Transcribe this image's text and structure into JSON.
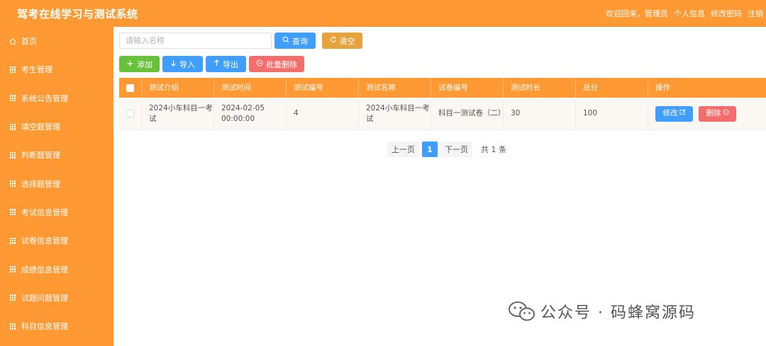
{
  "header": {
    "app_title": "驾考在线学习与测试系统",
    "welcome": "欢迎回来，管理员",
    "links": [
      "个人信息",
      "修改密码",
      "注销"
    ]
  },
  "sidebar": {
    "items": [
      {
        "label": "首页",
        "icon": "home-icon"
      },
      {
        "label": "考生管理",
        "icon": "grid-icon"
      },
      {
        "label": "系统公告管理",
        "icon": "grid-icon"
      },
      {
        "label": "填空题管理",
        "icon": "grid-icon"
      },
      {
        "label": "判断题管理",
        "icon": "grid-icon"
      },
      {
        "label": "选择题管理",
        "icon": "grid-icon"
      },
      {
        "label": "考试信息管理",
        "icon": "grid-icon"
      },
      {
        "label": "试卷信息管理",
        "icon": "grid-icon"
      },
      {
        "label": "成绩信息管理",
        "icon": "grid-icon"
      },
      {
        "label": "试题问题管理",
        "icon": "grid-icon"
      },
      {
        "label": "科目信息管理",
        "icon": "grid-icon"
      }
    ]
  },
  "search": {
    "placeholder": "请输入名称",
    "value": "",
    "query_label": "查询",
    "reset_label": "清空"
  },
  "toolbar": {
    "add_label": "添加",
    "import_label": "导入",
    "export_label": "导出",
    "batch_delete_label": "批量删除"
  },
  "table": {
    "columns": [
      "测试介绍",
      "测试时间",
      "测试编号",
      "测试名称",
      "试卷编号",
      "测试时长",
      "总分",
      "操作"
    ],
    "rows": [
      {
        "intro": "2024小车科目一考试",
        "time": "2024-02-05 00:00:00",
        "code": "4",
        "name": "2024小车科目一考试",
        "paper": "科目一测试卷（二）",
        "duration": "30",
        "score": "100",
        "edit_label": "修改",
        "delete_label": "删除"
      }
    ]
  },
  "pagination": {
    "prev_label": "上一页",
    "current_page": "1",
    "next_label": "下一页",
    "total": "共 1 条"
  },
  "watermark": {
    "text": "公众号 · 码蜂窝源码"
  },
  "colors": {
    "primary": "#ff9933",
    "blue": "#409eff",
    "gold": "#e6a23c",
    "green": "#67c23a",
    "red": "#f56c6c"
  }
}
